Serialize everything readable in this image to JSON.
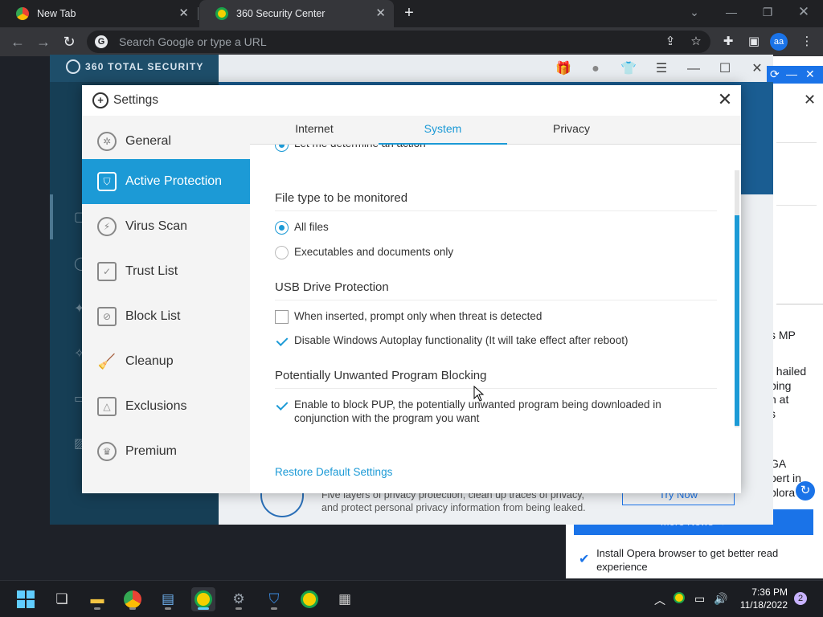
{
  "browser": {
    "tabs": [
      {
        "title": "New Tab",
        "icon": "chrome-icon"
      },
      {
        "title": "360 Security Center",
        "icon": "360-icon"
      }
    ],
    "omnibox_placeholder": "Search Google or type a URL",
    "profile_initials": "aa"
  },
  "app360": {
    "brand": "360 TOTAL SECURITY",
    "footer_line1": "Five layers of privacy protection, clean up traces of privacy,",
    "footer_line2": "and protect personal privacy information from being leaked.",
    "try_now": "Try Now",
    "accent": "#1c9ad6"
  },
  "news": {
    "fragments": [
      "t",
      "s MP",
      ", hailed",
      "ping",
      "h at",
      "s",
      "GA",
      "pert in",
      "plora"
    ],
    "more_news": "More News →",
    "opera_text": "Install Opera browser to get better read experience"
  },
  "dialog": {
    "title": "Settings",
    "sidebar": [
      {
        "label": "General",
        "icon": "gear-icon"
      },
      {
        "label": "Active Protection",
        "icon": "shield-icon"
      },
      {
        "label": "Virus Scan",
        "icon": "scan-icon"
      },
      {
        "label": "Trust List",
        "icon": "trust-list-icon"
      },
      {
        "label": "Block List",
        "icon": "block-list-icon"
      },
      {
        "label": "Cleanup",
        "icon": "broom-icon"
      },
      {
        "label": "Exclusions",
        "icon": "exclusion-icon"
      },
      {
        "label": "Premium",
        "icon": "crown-icon"
      }
    ],
    "active_sidebar": "Active Protection",
    "tabs": [
      "Internet",
      "System",
      "Privacy"
    ],
    "active_tab": "System",
    "cut_option": "Let me determine an action",
    "file_type": {
      "heading": "File type to be monitored",
      "options": [
        {
          "label": "All files",
          "selected": true
        },
        {
          "label": "Executables and documents only",
          "selected": false
        }
      ]
    },
    "usb": {
      "heading": "USB Drive Protection",
      "options": [
        {
          "label": "When inserted, prompt only when threat is detected",
          "checked": false
        },
        {
          "label": "Disable Windows Autoplay functionality (It will take effect after reboot)",
          "checked": true
        }
      ]
    },
    "pup": {
      "heading": "Potentially Unwanted Program Blocking",
      "option_line1": "Enable to block PUP, the potentially unwanted program being downloaded in",
      "option_line2": "conjunction with the program you want",
      "checked": true
    },
    "restore_label": "Restore Default Settings"
  },
  "taskbar": {
    "apps": [
      "windows-start-icon",
      "task-view-icon",
      "file-explorer-icon",
      "chrome-icon",
      "paint-icon",
      "360-icon",
      "settings-icon",
      "defender-icon",
      "360-icon",
      "notepad-icon"
    ],
    "time": "7:36 PM",
    "date": "11/18/2022",
    "notifications": "2"
  }
}
